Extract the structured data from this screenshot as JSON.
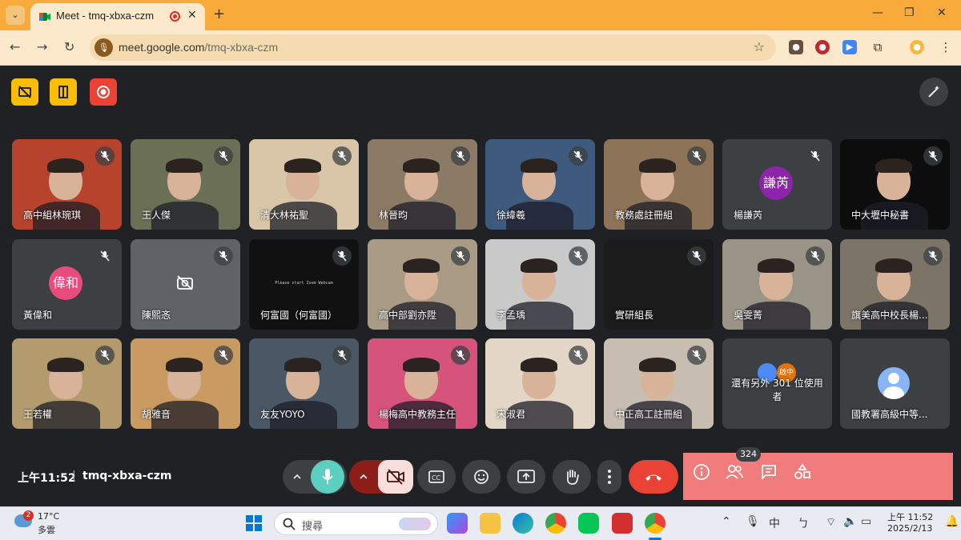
{
  "browser": {
    "tab_title": "Meet - tmq-xbxa-czm",
    "url_host": "meet.google.com",
    "url_path": "/tmq-xbxa-czm"
  },
  "participants": [
    {
      "name": "高中組林琬琪",
      "bg": "#b8432c",
      "type": "video"
    },
    {
      "name": "王人傑",
      "bg": "#6b6f55",
      "type": "video"
    },
    {
      "name": "清大林祐聖",
      "bg": "#d9c6a8",
      "type": "video"
    },
    {
      "name": "林晉昀",
      "bg": "#8a7a66",
      "type": "video"
    },
    {
      "name": "徐緯羲",
      "bg": "#3e5a7c",
      "type": "video"
    },
    {
      "name": "教務處註冊組",
      "bg": "#8d7358",
      "type": "video"
    },
    {
      "name": "楊謙芮",
      "bg": "#3c4043",
      "type": "avatar",
      "initials": "謙芮",
      "avatar_color": "#8e24aa"
    },
    {
      "name": "中大壢中秘書",
      "bg": "#0d0d0d",
      "type": "video"
    },
    {
      "name": "黃偉和",
      "bg": "#3c4043",
      "type": "avatar",
      "initials": "偉和",
      "avatar_color": "#e84c7d"
    },
    {
      "name": "陳熙忞",
      "bg": "#5f6368",
      "type": "cam-off"
    },
    {
      "name": "何富國（何富國）",
      "bg": "#111111",
      "type": "text-screen",
      "screen_text": "Please start Zoom Webcam"
    },
    {
      "name": "高中部劉亦陞",
      "bg": "#a99b86",
      "type": "video"
    },
    {
      "name": "李孟瑀",
      "bg": "#c9c9c9",
      "type": "video"
    },
    {
      "name": "實研組長",
      "bg": "#1b1b1b",
      "type": "blank"
    },
    {
      "name": "吳雯菁",
      "bg": "#9a9488",
      "type": "video"
    },
    {
      "name": "旗美高中校長楊...",
      "bg": "#7d7468",
      "type": "video"
    },
    {
      "name": "王若權",
      "bg": "#b49b6e",
      "type": "video"
    },
    {
      "name": "胡雅音",
      "bg": "#c99a62",
      "type": "video"
    },
    {
      "name": "友友YOYO",
      "bg": "#4a5866",
      "type": "video"
    },
    {
      "name": "楊梅高中教務主任",
      "bg": "#d6547b",
      "type": "video"
    },
    {
      "name": "宋淑君",
      "bg": "#e2d7c6",
      "type": "video"
    },
    {
      "name": "中正高工註冊組",
      "bg": "#c7bdb0",
      "type": "video"
    },
    {
      "name": "還有另外 301 位使用者",
      "bg": "#3c4043",
      "type": "others",
      "mini_label": "啟中"
    },
    {
      "name": "國教署高級中等...",
      "bg": "#3c4043",
      "type": "person-icon"
    }
  ],
  "meeting": {
    "time": "上午11:52",
    "code": "tmq-xbxa-czm",
    "participant_count": "324"
  },
  "taskbar": {
    "weather_badge": "2",
    "temperature": "17°C",
    "condition": "多雲",
    "search_placeholder": "搜尋",
    "ime": "中",
    "time": "上午 11:52",
    "date": "2025/2/13"
  }
}
